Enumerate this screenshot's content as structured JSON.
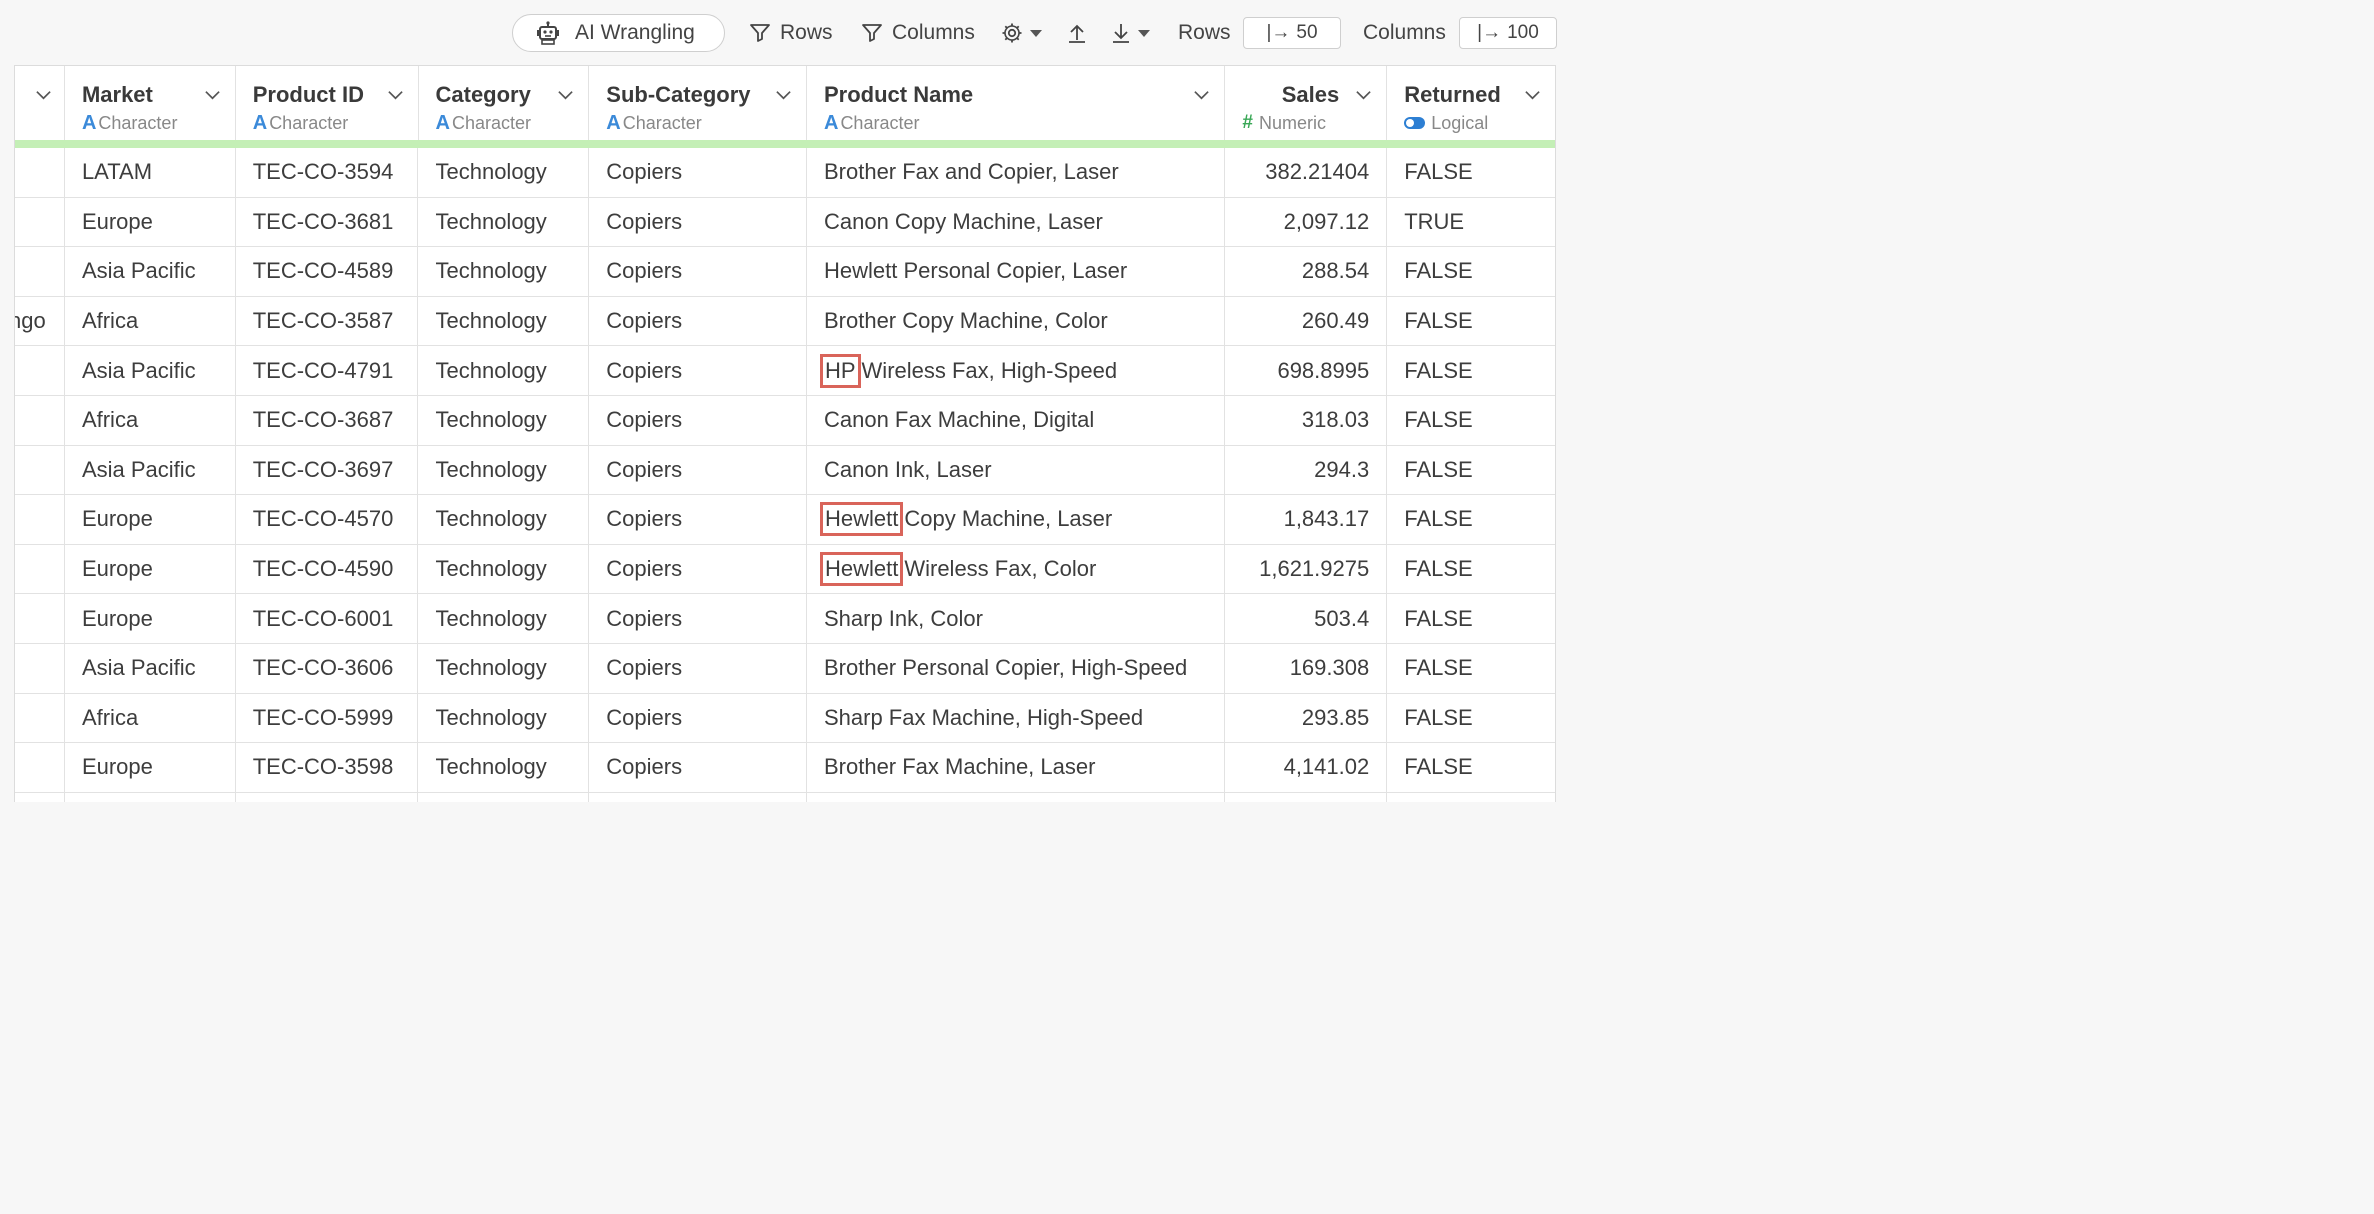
{
  "toolbar": {
    "ai_label": "AI Wrangling",
    "rows_filter_label": "Rows",
    "columns_filter_label": "Columns",
    "rows_count_label": "Rows",
    "rows_count_value": "50",
    "columns_count_label": "Columns",
    "columns_count_value": "100",
    "limit_glyph": "|→"
  },
  "columns": [
    {
      "name": "",
      "type": ""
    },
    {
      "name": "Market",
      "type": "Character"
    },
    {
      "name": "Product ID",
      "type": "Character"
    },
    {
      "name": "Category",
      "type": "Character"
    },
    {
      "name": "Sub-Category",
      "type": "Character"
    },
    {
      "name": "Product Name",
      "type": "Character"
    },
    {
      "name": "Sales",
      "type": "Numeric"
    },
    {
      "name": "Returned",
      "type": "Logical"
    }
  ],
  "rows": [
    {
      "prev": "",
      "market": "LATAM",
      "product_id": "TEC-CO-3594",
      "category": "Technology",
      "sub_category": "Copiers",
      "name_highlight": "",
      "name_rest": "Brother Fax and Copier, Laser",
      "sales": "382.21404",
      "returned": "FALSE"
    },
    {
      "prev": "",
      "market": "Europe",
      "product_id": "TEC-CO-3681",
      "category": "Technology",
      "sub_category": "Copiers",
      "name_highlight": "",
      "name_rest": "Canon Copy Machine, Laser",
      "sales": "2,097.12",
      "returned": "TRUE"
    },
    {
      "prev": "",
      "market": "Asia Pacific",
      "product_id": "TEC-CO-4589",
      "category": "Technology",
      "sub_category": "Copiers",
      "name_highlight": "",
      "name_rest": "Hewlett Personal Copier, Laser",
      "sales": "288.54",
      "returned": "FALSE"
    },
    {
      "prev": "ngo",
      "market": "Africa",
      "product_id": "TEC-CO-3587",
      "category": "Technology",
      "sub_category": "Copiers",
      "name_highlight": "",
      "name_rest": "Brother Copy Machine, Color",
      "sales": "260.49",
      "returned": "FALSE"
    },
    {
      "prev": "",
      "market": "Asia Pacific",
      "product_id": "TEC-CO-4791",
      "category": "Technology",
      "sub_category": "Copiers",
      "name_highlight": "HP",
      "name_rest": "Wireless Fax, High-Speed",
      "sales": "698.8995",
      "returned": "FALSE"
    },
    {
      "prev": "",
      "market": "Africa",
      "product_id": "TEC-CO-3687",
      "category": "Technology",
      "sub_category": "Copiers",
      "name_highlight": "",
      "name_rest": "Canon Fax Machine, Digital",
      "sales": "318.03",
      "returned": "FALSE"
    },
    {
      "prev": "",
      "market": "Asia Pacific",
      "product_id": "TEC-CO-3697",
      "category": "Technology",
      "sub_category": "Copiers",
      "name_highlight": "",
      "name_rest": "Canon Ink, Laser",
      "sales": "294.3",
      "returned": "FALSE"
    },
    {
      "prev": "",
      "market": "Europe",
      "product_id": "TEC-CO-4570",
      "category": "Technology",
      "sub_category": "Copiers",
      "name_highlight": "Hewlett",
      "name_rest": "Copy Machine, Laser",
      "sales": "1,843.17",
      "returned": "FALSE"
    },
    {
      "prev": "",
      "market": "Europe",
      "product_id": "TEC-CO-4590",
      "category": "Technology",
      "sub_category": "Copiers",
      "name_highlight": "Hewlett",
      "name_rest": "Wireless Fax, Color",
      "sales": "1,621.9275",
      "returned": "FALSE"
    },
    {
      "prev": "",
      "market": "Europe",
      "product_id": "TEC-CO-6001",
      "category": "Technology",
      "sub_category": "Copiers",
      "name_highlight": "",
      "name_rest": "Sharp Ink, Color",
      "sales": "503.4",
      "returned": "FALSE"
    },
    {
      "prev": "",
      "market": "Asia Pacific",
      "product_id": "TEC-CO-3606",
      "category": "Technology",
      "sub_category": "Copiers",
      "name_highlight": "",
      "name_rest": "Brother Personal Copier, High-Speed",
      "sales": "169.308",
      "returned": "FALSE"
    },
    {
      "prev": "",
      "market": "Africa",
      "product_id": "TEC-CO-5999",
      "category": "Technology",
      "sub_category": "Copiers",
      "name_highlight": "",
      "name_rest": "Sharp Fax Machine, High-Speed",
      "sales": "293.85",
      "returned": "FALSE"
    },
    {
      "prev": "",
      "market": "Europe",
      "product_id": "TEC-CO-3598",
      "category": "Technology",
      "sub_category": "Copiers",
      "name_highlight": "",
      "name_rest": "Brother Fax Machine, Laser",
      "sales": "4,141.02",
      "returned": "FALSE"
    },
    {
      "prev": "",
      "market": "",
      "product_id": "",
      "category": "",
      "sub_category": "",
      "name_highlight": "",
      "name_rest": "",
      "sales": "",
      "returned": ""
    }
  ],
  "icons": {
    "ai": "robot-icon",
    "rows_filter": "funnel-icon",
    "columns_filter": "funnel-icon",
    "settings": "gear-icon",
    "export": "upload-icon",
    "import": "download-icon",
    "column_menu": "chevron-down-icon",
    "character_type": "letter-a-icon",
    "numeric_type": "hash-icon",
    "logical_type": "toggle-icon"
  },
  "colors": {
    "highlight_box": "#d9645a",
    "character_type": "#3b8ad9",
    "numeric_type": "#3aa857",
    "logical_type": "#2d7fd3",
    "header_bar": "#c4efb6"
  }
}
